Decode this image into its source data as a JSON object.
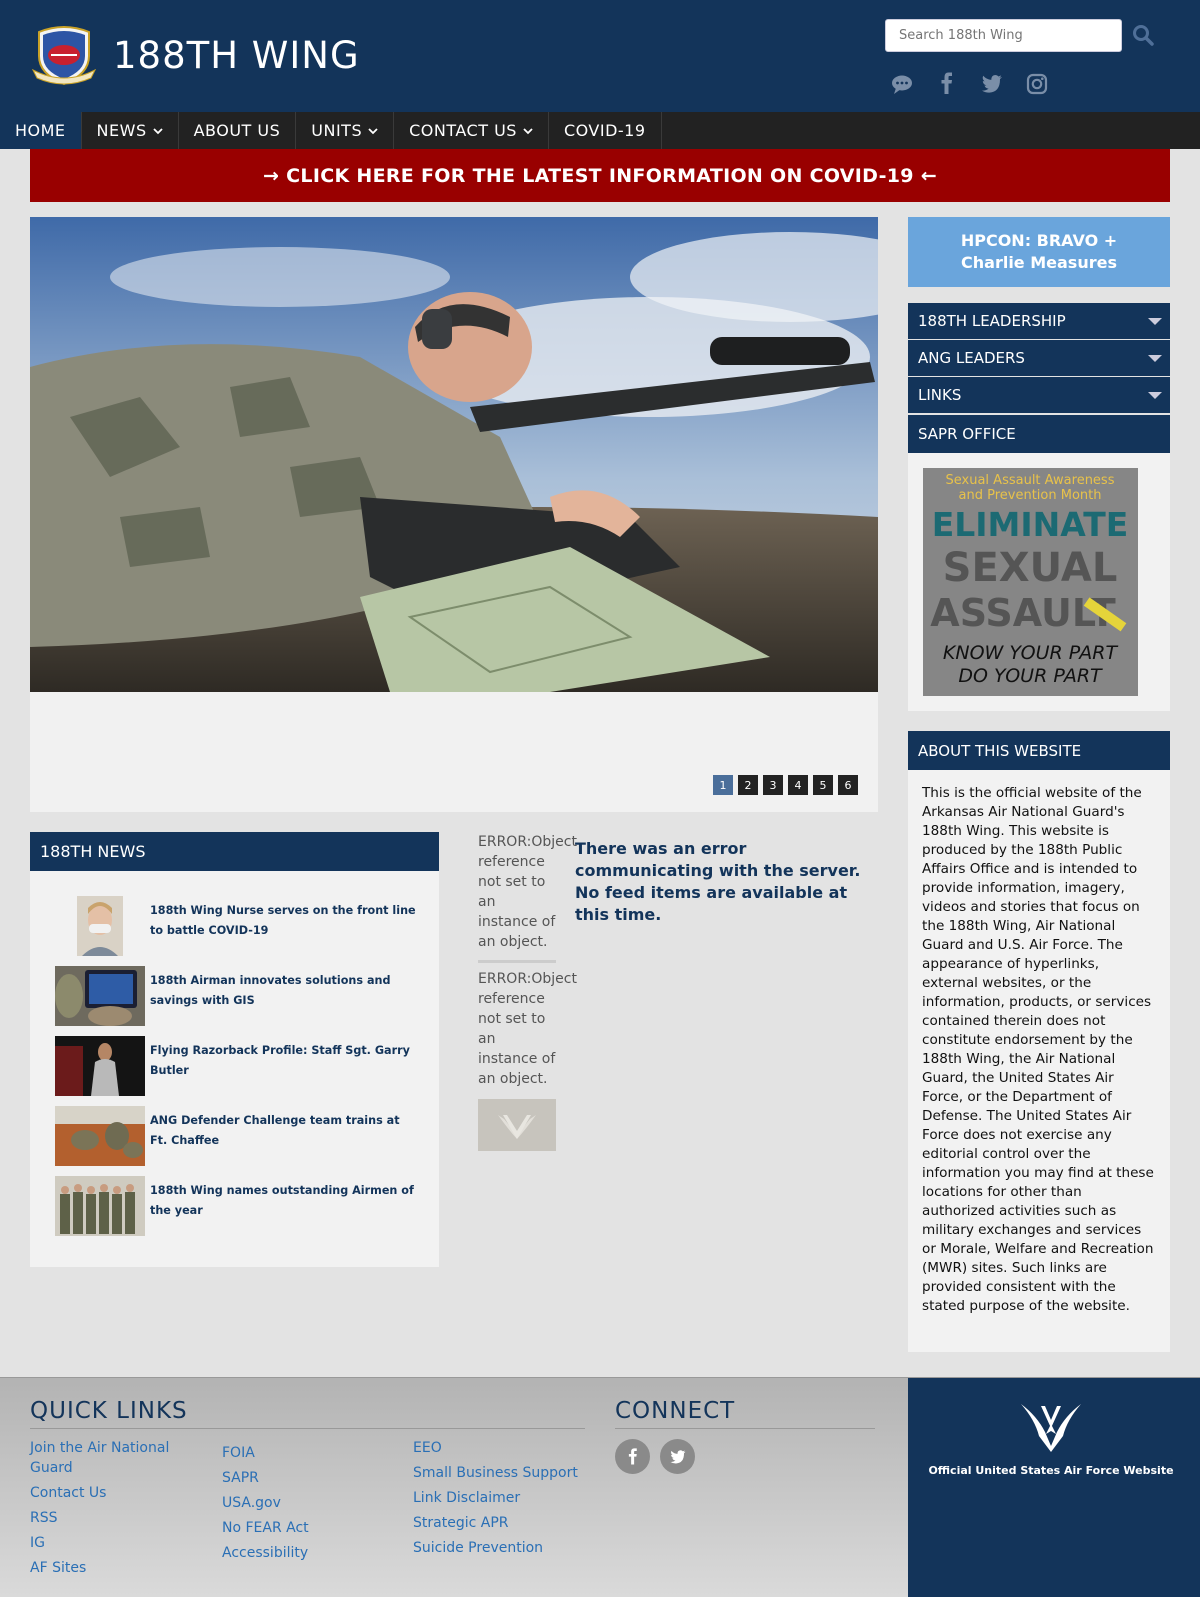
{
  "header": {
    "site_title": "188TH WING",
    "search_placeholder": "Search 188th Wing",
    "social": [
      "chat-icon",
      "facebook-icon",
      "twitter-icon",
      "instagram-icon"
    ]
  },
  "nav": [
    {
      "label": "HOME",
      "active": true,
      "dropdown": false
    },
    {
      "label": "NEWS",
      "active": false,
      "dropdown": true
    },
    {
      "label": "ABOUT US",
      "active": false,
      "dropdown": false
    },
    {
      "label": "UNITS",
      "active": false,
      "dropdown": true
    },
    {
      "label": "CONTACT US",
      "active": false,
      "dropdown": true
    },
    {
      "label": "COVID-19",
      "active": false,
      "dropdown": false
    }
  ],
  "covid_banner": "→ CLICK HERE FOR THE LATEST INFORMATION ON COVID-19 ←",
  "slider": {
    "pages": [
      "1",
      "2",
      "3",
      "4",
      "5",
      "6"
    ],
    "active_page": "1"
  },
  "sidebar": {
    "hpcon_line1": "HPCON: BRAVO +",
    "hpcon_line2": "Charlie Measures",
    "menus": [
      "188TH LEADERSHIP",
      "ANG LEADERS",
      "LINKS"
    ],
    "sapr_title": "SAPR OFFICE",
    "sapr_poster": {
      "line1": "Sexual Assault Awareness",
      "line2": "and Prevention Month",
      "line3": "ELIMINATE",
      "line4": "SEXUAL",
      "line5": "ASSAULT",
      "line6": "KNOW YOUR PART",
      "line7": "DO YOUR PART"
    },
    "about_title": "ABOUT THIS WEBSITE",
    "about_text": "This is the official website of the Arkansas Air National Guard's 188th Wing. This website is produced by the 188th Public Affairs Office and is intended to provide information, imagery, videos and stories that focus on the 188th Wing, Air National Guard and U.S. Air Force. The appearance of hyperlinks, external websites, or the information, products, or services contained therein does not constitute endorsement by the 188th Wing, the Air National Guard, the United States Air Force, or the Department of Defense. The United States Air Force does not exercise any editorial control over the information you may find at these locations for other than authorized activities such as military exchanges and services or Morale, Welfare and Recreation (MWR) sites. Such links are provided consistent with the stated purpose of the website."
  },
  "news": {
    "title": "188TH NEWS",
    "items": [
      "188th Wing Nurse serves on the front line to battle COVID-19",
      "188th Airman innovates solutions and savings with GIS",
      "Flying Razorback Profile: Staff Sgt. Garry Butler",
      "ANG Defender Challenge team trains at Ft. Chaffee",
      "188th Wing names outstanding Airmen of the year"
    ]
  },
  "errors": {
    "item1": "ERROR:Object reference not set to an instance of an object.",
    "item2": "ERROR:Object reference not set to an instance of an object.",
    "server": "There was an error communicating with the server. No feed items are available at this time."
  },
  "footer": {
    "quick_links_title": "QUICK LINKS",
    "connect_title": "CONNECT",
    "col1": [
      "Join the Air National Guard",
      "Contact Us",
      "RSS",
      "IG",
      "AF Sites"
    ],
    "col2": [
      "FOIA",
      "SAPR",
      "USA.gov",
      "No FEAR Act",
      "Accessibility"
    ],
    "col3": [
      "EEO",
      "Small Business Support",
      "Link Disclaimer",
      "Strategic APR",
      "Suicide Prevention"
    ],
    "af_text": "Official United States Air Force Website"
  },
  "colors": {
    "navy": "#13345a",
    "banner_red": "#990000",
    "hpcon_blue": "#6aa5dc",
    "link_blue": "#2a6fb5"
  }
}
